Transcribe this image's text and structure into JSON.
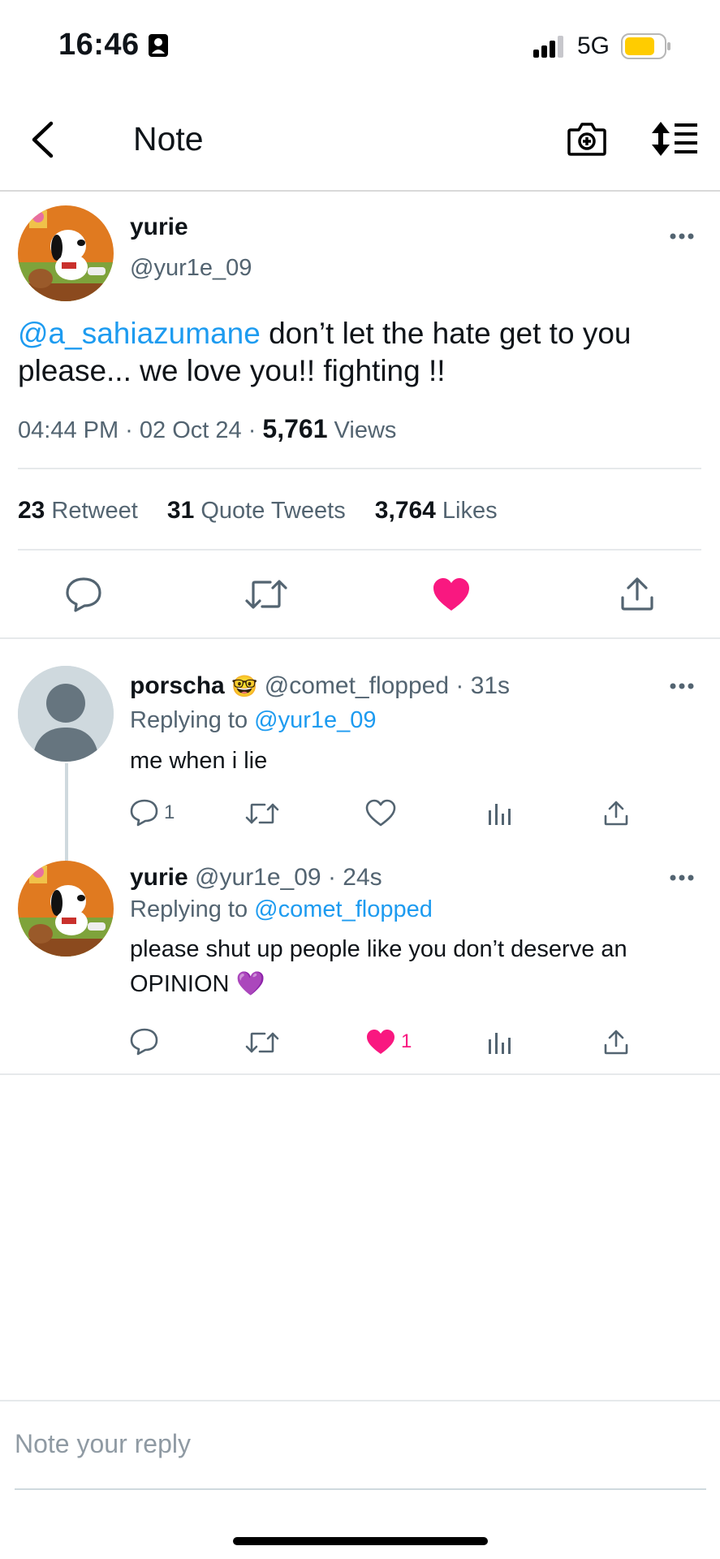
{
  "status_bar": {
    "time": "16:46",
    "network": "5G",
    "battery_color": "#ffcc00"
  },
  "header": {
    "title": "Note"
  },
  "tweet": {
    "author_name": "yurie",
    "author_handle": "@yur1e_09",
    "mention": "@a_sahiazumane",
    "text": " don’t let the hate get to you please... we love you!! fighting !!",
    "time": "04:44 PM · 02 Oct 24 · ",
    "views_count": "5,761",
    "views_label": " Views",
    "retweets_count": "23",
    "retweets_label": " Retweet",
    "quotes_count": "31",
    "quotes_label": " Quote Tweets",
    "likes_count": "3,764",
    "likes_label": " Likes"
  },
  "replies": [
    {
      "name": "porscha",
      "emoji": "🤓",
      "handle_time": " @comet_flopped · 31s",
      "replying_label": "Replying to ",
      "replying_to": "@yur1e_09",
      "text": "me when i lie",
      "reply_count": "1",
      "like_count": ""
    },
    {
      "name": "yurie",
      "emoji": "",
      "handle_time": " @yur1e_09 · 24s",
      "replying_label": "Replying to ",
      "replying_to": "@comet_flopped",
      "text": "please shut up people like you don’t deserve an OPINION 💜",
      "reply_count": "",
      "like_count": "1"
    }
  ],
  "composer": {
    "placeholder": "Note your reply"
  },
  "colors": {
    "accent": "#1d9bf0",
    "like": "#f91880"
  }
}
